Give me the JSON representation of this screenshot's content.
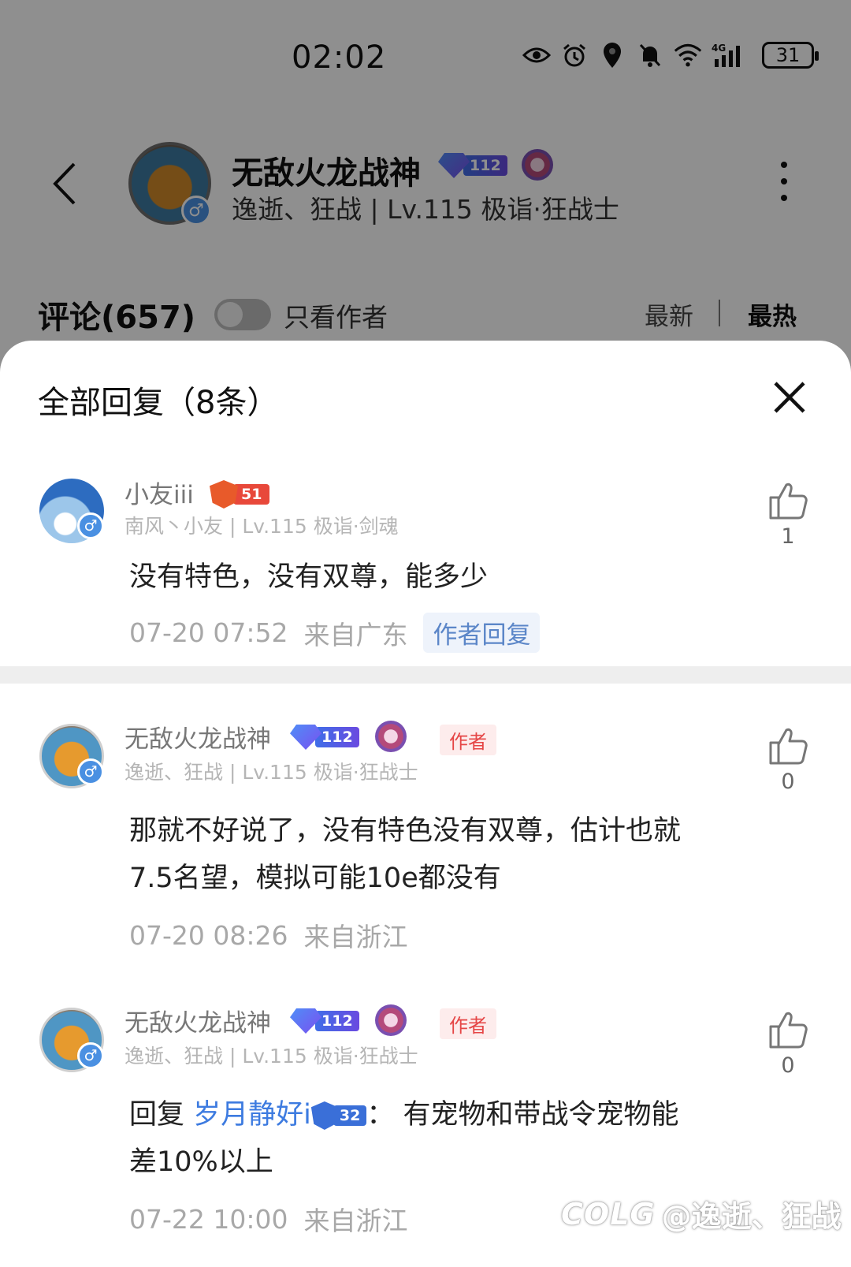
{
  "status_bar": {
    "time": "02:02",
    "battery": "31",
    "network": "4G"
  },
  "header": {
    "name": "无敌火龙战神",
    "level_badge": "112",
    "subtitle": "逸逝、狂战 | Lv.115 极诣·狂战士"
  },
  "comments_bar": {
    "title": "评论(657)",
    "only_author_label": "只看作者",
    "sort_new": "最新",
    "sort_hot": "最热"
  },
  "sheet": {
    "title": "全部回复（8条）",
    "comments": [
      {
        "name": "小友iii",
        "badge_num": "51",
        "sub": "南风丶小友 | Lv.115 极诣·剑魂",
        "text": "没有特色，没有双尊，能多少",
        "time": "07-20 07:52",
        "location": "来自广东",
        "tag": "作者回复",
        "likes": "1"
      },
      {
        "name": "无敌火龙战神",
        "level_badge": "112",
        "author_tag": "作者",
        "sub": "逸逝、狂战 | Lv.115 极诣·狂战士",
        "text_line1": "那就不好说了，没有特色没有双尊，估计也就",
        "text_line2": "7.5名望，模拟可能10e都没有",
        "time": "07-20 08:26",
        "location": "来自浙江",
        "likes": "0"
      },
      {
        "name": "无敌火龙战神",
        "level_badge": "112",
        "author_tag": "作者",
        "sub": "逸逝、狂战 | Lv.115 极诣·狂战士",
        "reply_prefix": "回复 ",
        "reply_to": "岁月静好i",
        "reply_badge": "32",
        "text_rest": "：  有宠物和带战令宠物能",
        "text_line2": "差10%以上",
        "time": "07-22 10:00",
        "location": "来自浙江",
        "likes": "0"
      }
    ]
  },
  "watermark": {
    "logo": "COLG",
    "text": "@逸逝、狂战"
  },
  "colors": {
    "accent_blue": "#3d7be0",
    "author_red": "#e54646",
    "dim_overlay": "rgba(0,0,0,0.44)"
  }
}
